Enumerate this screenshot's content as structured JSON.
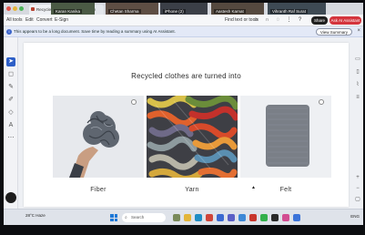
{
  "tabs": [
    {
      "label": "Recycle Money.pdf",
      "active": true
    },
    {
      "label": "+ New"
    }
  ],
  "participants": [
    "Karan Kanika",
    "Chetan Sharma",
    "iPhone (2)",
    "Aastesh Karnat",
    "Vihranth Raf Surat"
  ],
  "toolbar": {
    "items": [
      "All tools",
      "Edit",
      "Convert",
      "E-Sign"
    ],
    "find_label": "Find text or tools",
    "share_label": "Share",
    "ai_label": "Ask AI Assistant"
  },
  "banner": {
    "text": "This appears to be a long document. Save time by reading a summary using AI Assistant.",
    "button": "View Summary"
  },
  "document": {
    "heading": "Recycled clothes are turned into",
    "items": [
      {
        "caption": "Fiber"
      },
      {
        "caption": "Yarn"
      },
      {
        "caption": "Felt"
      }
    ]
  },
  "taskbar": {
    "weather": "28°C Haze",
    "search_placeholder": "Search",
    "system": "ENG"
  },
  "colors": {
    "accent": "#2d5fc7",
    "ai_button": "#d4343c"
  }
}
